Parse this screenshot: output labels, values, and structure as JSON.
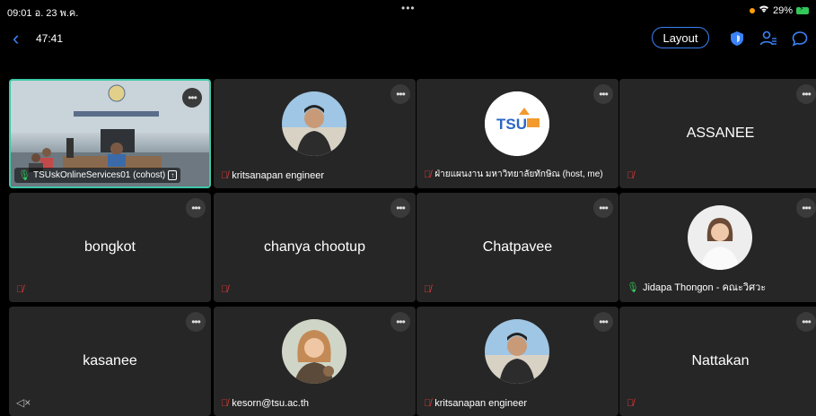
{
  "status": {
    "time_date": "09:01  อ. 23 พ.ค.",
    "dots": "•••",
    "battery": "29%"
  },
  "topbar": {
    "timer": "47:41",
    "layout_label": "Layout"
  },
  "colors": {
    "accent": "#3b82f6",
    "active_border": "#3ec9a8",
    "muted": "#e53935",
    "mic_on": "#34c759",
    "tile_bg": "#262626"
  },
  "tiles": [
    {
      "label": "TSUskOnlineServices01 (cohost)",
      "mic": "on",
      "video": true
    },
    {
      "label": "kritsanapan engineer",
      "mic": "muted",
      "avatar": "person"
    },
    {
      "label": "ฝ่ายแผนงาน มหาวิทยาลัยทักษิณ (host, me)",
      "mic": "muted",
      "avatar": "logo"
    },
    {
      "name": "ASSANEE",
      "mic": "muted"
    },
    {
      "name": "bongkot",
      "mic": "muted"
    },
    {
      "name": "chanya chootup",
      "mic": "muted"
    },
    {
      "name": "Chatpavee",
      "mic": "muted"
    },
    {
      "label": "Jidapa Thongon - คณะวิศวะ",
      "mic": "on",
      "avatar": "woman"
    },
    {
      "name": "kasanee",
      "mic": "speaker"
    },
    {
      "label": "kesorn@tsu.ac.th",
      "mic": "muted",
      "avatar": "woman2"
    },
    {
      "label": "kritsanapan engineer",
      "mic": "muted",
      "avatar": "person"
    },
    {
      "name": "Nattakan",
      "mic": "muted"
    }
  ]
}
